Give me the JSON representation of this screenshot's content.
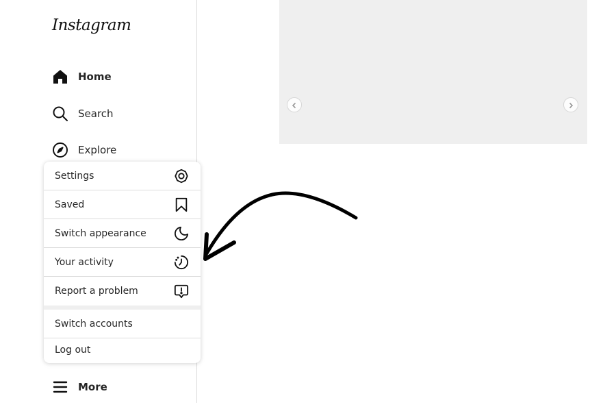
{
  "app": {
    "logo_text": "Instagram"
  },
  "sidebar": {
    "items": [
      {
        "label": "Home",
        "icon": "home-icon",
        "active": true
      },
      {
        "label": "Search",
        "icon": "search-icon",
        "active": false
      },
      {
        "label": "Explore",
        "icon": "compass-icon",
        "active": false
      }
    ],
    "more_label": "More",
    "more_icon": "hamburger-icon"
  },
  "more_menu": {
    "items": [
      {
        "label": "Settings",
        "icon": "gear-icon"
      },
      {
        "label": "Saved",
        "icon": "bookmark-icon"
      },
      {
        "label": "Switch appearance",
        "icon": "moon-icon"
      },
      {
        "label": "Your activity",
        "icon": "activity-icon"
      },
      {
        "label": "Report a problem",
        "icon": "report-icon"
      }
    ],
    "secondary_items": [
      {
        "label": "Switch accounts"
      },
      {
        "label": "Log out"
      }
    ]
  },
  "colors": {
    "text": "#262626",
    "border": "#dbdbdb",
    "media_placeholder": "#efefef",
    "annotation_arrow": "#000000"
  },
  "carousel": {
    "prev_icon": "chevron-left-icon",
    "next_icon": "chevron-right-icon"
  },
  "annotation": {
    "icon": "curved-arrow-icon"
  }
}
